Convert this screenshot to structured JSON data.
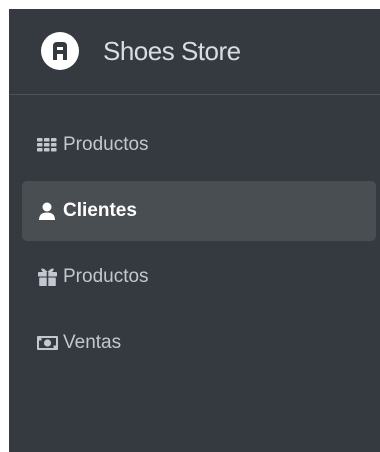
{
  "brand": {
    "title": "Shoes Store",
    "logo_icon": "app-logo-icon"
  },
  "nav": {
    "items": [
      {
        "label": "Productos",
        "icon": "th-grid-icon",
        "active": false
      },
      {
        "label": "Clientes",
        "icon": "user-icon",
        "active": true
      },
      {
        "label": "Productos",
        "icon": "gift-box-icon",
        "active": false
      },
      {
        "label": "Ventas",
        "icon": "money-bill-icon",
        "active": false
      }
    ]
  },
  "colors": {
    "sidebar_bg": "#343a40",
    "active_bg": "#494e53",
    "text": "#c2c7d0",
    "active_text": "#ffffff"
  }
}
